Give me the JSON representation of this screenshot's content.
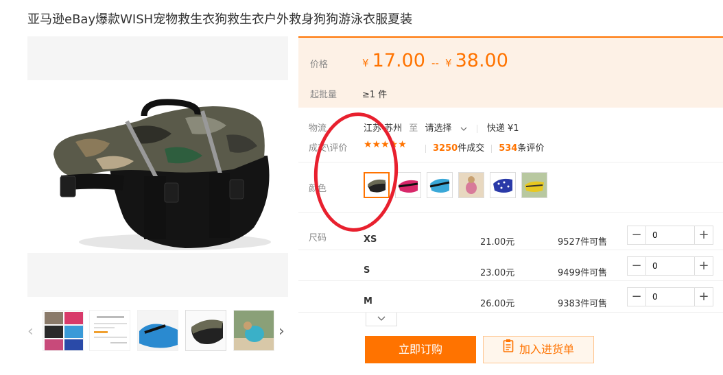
{
  "product": {
    "title": "亚马逊eBay爆款WISH宠物救生衣狗救生衣户外救身狗狗游泳衣服夏装"
  },
  "gallery": {
    "main_image_icon": "dog-life-vest-camo-image",
    "thumbnails": [
      {
        "icon": "vest-collage-thumbnail"
      },
      {
        "icon": "certificate-document-thumbnail"
      },
      {
        "icon": "blue-vest-thumbnail"
      },
      {
        "icon": "camo-vest-thumbnail"
      },
      {
        "icon": "dog-wearing-vest-thumbnail"
      }
    ],
    "prev_arrow": "‹",
    "next_arrow": "›"
  },
  "pricing": {
    "price_label": "价格",
    "currency": "¥",
    "price_min": "17.00",
    "range_sep": "--",
    "price_max": "38.00",
    "moq_label": "起批量",
    "moq_value": "≥1 件"
  },
  "logistics": {
    "label": "物流",
    "origin": "江苏 苏州",
    "to": "至",
    "destination": "请选择",
    "shipping": "快递 ¥1"
  },
  "transactions": {
    "label": "成交\\评价",
    "stars": "★★★★★",
    "deals_count": "3250",
    "deals_text": "件成交",
    "reviews_count": "534",
    "reviews_text": "条评价"
  },
  "color": {
    "label": "颜色",
    "options": [
      {
        "icon": "camo-vest-swatch",
        "selected": true
      },
      {
        "icon": "red-vest-swatch",
        "selected": false
      },
      {
        "icon": "blue-vest-swatch",
        "selected": false
      },
      {
        "icon": "dog-photo-swatch",
        "selected": false
      },
      {
        "icon": "blue-dot-vest-swatch",
        "selected": false
      },
      {
        "icon": "yellow-vest-swatch",
        "selected": false
      }
    ]
  },
  "sizes": {
    "label": "尺码",
    "rows": [
      {
        "name": "XS",
        "price": "21.00元",
        "stock": "9527件可售",
        "qty": "0"
      },
      {
        "name": "S",
        "price": "23.00元",
        "stock": "9499件可售",
        "qty": "0"
      },
      {
        "name": "M",
        "price": "26.00元",
        "stock": "9383件可售",
        "qty": "0"
      }
    ],
    "expand_icon": "chevron-down-icon"
  },
  "actions": {
    "buy_label": "立即订购",
    "cart_label": "加入进货单"
  },
  "colors": {
    "accent": "#ff7300",
    "annotation": "#e8202e",
    "price_bg": "#fdf1e6"
  }
}
